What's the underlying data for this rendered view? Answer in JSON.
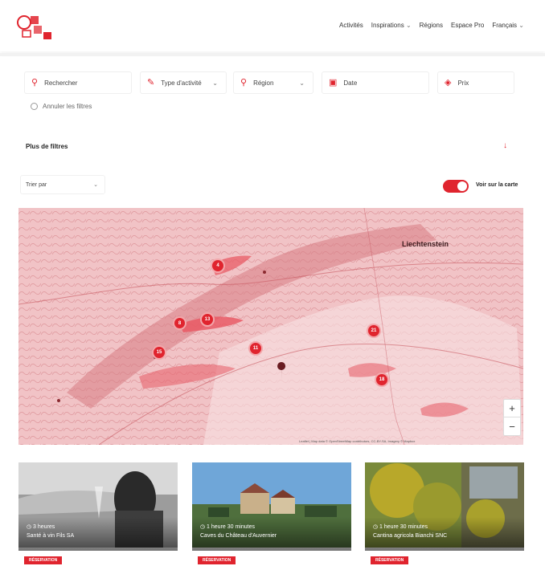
{
  "nav": {
    "items": [
      "Activités",
      "Inspirations",
      "Régions",
      "Espace Pro",
      "Français"
    ]
  },
  "filters": {
    "search_placeholder": "Rechercher",
    "activity_type": "Type d'activité",
    "region": "Région",
    "date": "Date",
    "price": "Prix",
    "reset": "Annuler les filtres"
  },
  "more_filters": "Plus de filtres",
  "sort_label": "Trier par",
  "map_toggle_label": "Voir sur la carte",
  "map": {
    "city_label": "Liechtenstein",
    "clusters": [
      "4",
      "8",
      "13",
      "15",
      "11",
      "21",
      "18"
    ],
    "zoom_in": "+",
    "zoom_out": "−",
    "attribution": "Leaflet | Map data © OpenStreetMap contributors, CC-BY-SA, Imagery © Mapbox"
  },
  "cards": [
    {
      "duration": "◷ 3 heures",
      "title": "Santé à vin Fils SA",
      "badge": "RÉSERVATION"
    },
    {
      "duration": "◷ 1 heure 30 minutes",
      "title": "Caves du Château d'Auvernier",
      "badge": "RÉSERVATION"
    },
    {
      "duration": "◷ 1 heure 30 minutes",
      "title": "Cantina agricola Bianchi SNC",
      "badge": "RÉSERVATION"
    }
  ],
  "colors": {
    "accent": "#e0242e",
    "map_base": "#f3c9cb"
  }
}
